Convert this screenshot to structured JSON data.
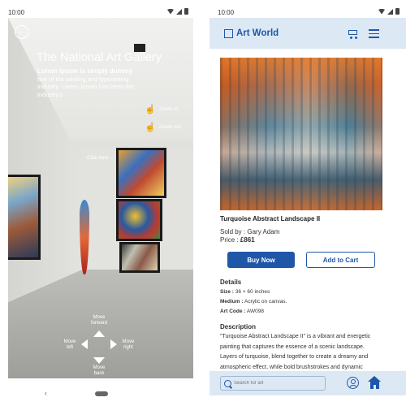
{
  "left_screen": {
    "status_time": "10:00",
    "gallery_title": "The National Art Gallery",
    "description_bold": "Lorem Ipsum is simply dummy",
    "description_text": "text of the printing and typesetting industry. Lorem Ipsum has been the industry's",
    "zoom_in_label": "Zoom in",
    "zoom_out_label": "Zoom out",
    "click_here_label": "Click here",
    "nav": {
      "forward": "Move forward",
      "left": "Move left",
      "right": "Move right",
      "back": "Move back"
    }
  },
  "right_screen": {
    "status_time": "10:00",
    "brand": "Art World",
    "product": {
      "title": "Turquoise Abstract Landscape II",
      "sold_by": "Sold by : Gary Adam",
      "price_label": "Price : ",
      "price_value": "£861"
    },
    "buttons": {
      "buy_now": "Buy Now",
      "add_to_cart": "Add to Cart"
    },
    "details": {
      "heading": "Details",
      "size_label": "Size :",
      "size_value": "36 × 60 inches",
      "medium_label": "Medium :",
      "medium_value": "Acrylic on canvas.",
      "code_label": "Art Code :",
      "code_value": "AW098"
    },
    "description": {
      "heading": "Description",
      "text": "\"Turquoise Abstract Landscape II\" is a vibrant and energetic painting that captures the essence of a scenic landscape. Layers of turquoise, blend together to create a dreamy and atmospheric effect, while bold brushstrokes and dynamic"
    },
    "search_placeholder": "Search for art"
  },
  "colors": {
    "brand_blue": "#1f57a8",
    "header_bg": "#dce8f4"
  },
  "icons": [
    "back-arrow-icon",
    "gallery-sign-icon",
    "zoom-in-hand-icon",
    "zoom-out-hand-icon",
    "pointer-hand-icon",
    "cart-icon",
    "menu-icon",
    "search-icon",
    "user-icon",
    "home-icon"
  ]
}
